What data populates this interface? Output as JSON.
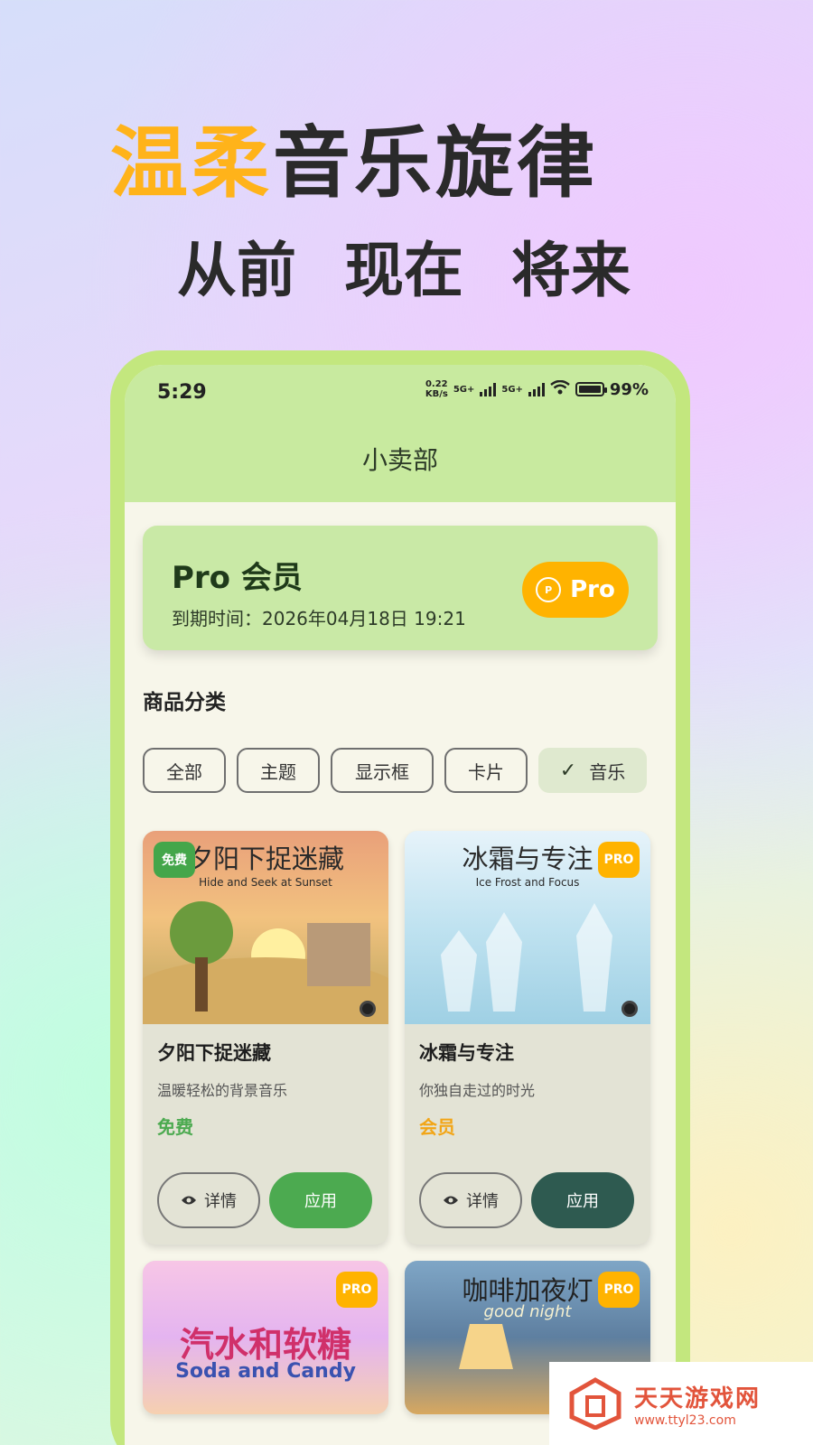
{
  "headline": {
    "accent": "温柔",
    "rest": "音乐旋律"
  },
  "subhead": "从前 现在 将来",
  "status": {
    "time": "5:29",
    "speed_value": "0.22",
    "speed_unit": "KB/s",
    "net1": "5G+",
    "net2": "5G+",
    "battery": "99%"
  },
  "page_title": "小卖部",
  "pro_card": {
    "title": "Pro 会员",
    "expire": "到期时间：2026年04月18日 19:21",
    "button_label": "Pro",
    "icon_text": "P"
  },
  "section_title": "商品分类",
  "chips": [
    "全部",
    "主题",
    "显示框",
    "卡片",
    "音乐"
  ],
  "selected_chip": "音乐",
  "cards": [
    {
      "cover_cn": "夕阳下捉迷藏",
      "cover_en": "Hide and Seek at Sunset",
      "badge": "免费",
      "name": "夕阳下捉迷藏",
      "desc": "温暖轻松的背景音乐",
      "price": "免费",
      "detail_label": "详情",
      "apply_label": "应用"
    },
    {
      "cover_cn": "冰霜与专注",
      "cover_en": "Ice Frost and Focus",
      "badge": "PRO",
      "name": "冰霜与专注",
      "desc": "你独自走过的时光",
      "price": "会员",
      "detail_label": "详情",
      "apply_label": "应用"
    },
    {
      "cover_cn": "汽水和软糖",
      "cover_en": "Soda and Candy",
      "badge": "PRO"
    },
    {
      "cover_cn": "咖啡加夜灯",
      "cover_en": "good night",
      "badge": "PRO"
    }
  ],
  "watermark": {
    "name": "天天游戏网",
    "url": "www.ttyl23.com"
  },
  "colors": {
    "accent": "#ffb31a",
    "phone_frame": "#c3e77e",
    "header": "#c8ea9f",
    "pro": "#ffb300",
    "free": "#4caa50",
    "apply_dark": "#2e5a50"
  },
  "icons": [
    "check-icon",
    "eye-icon",
    "wifi-icon",
    "battery-icon",
    "pro-coin-icon",
    "disc-icon"
  ]
}
